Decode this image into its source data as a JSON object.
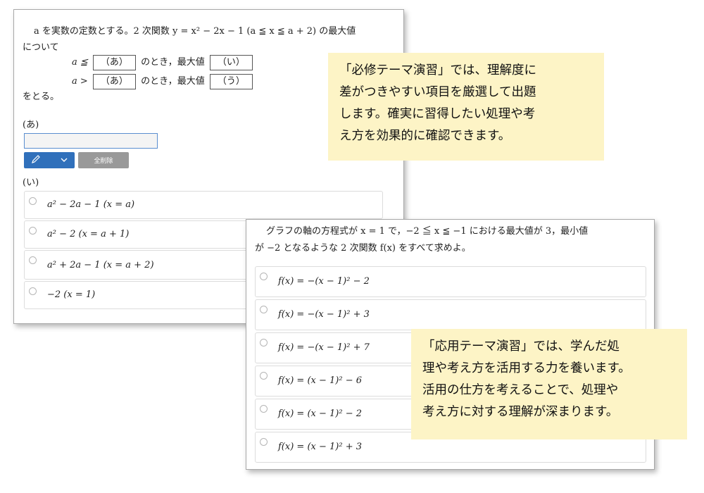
{
  "question1": {
    "line1": "a を実数の定数とする。2 次関数 y = x² − 2x − 1 (a ≦ x ≦ a + 2) の最大値",
    "line2": "について",
    "case1_lhs": "a ≦",
    "case2_lhs": "a >",
    "blank_a": "（あ）",
    "blank_i": "（い）",
    "blank_u": "（う）",
    "case_mid": "のとき，最大値",
    "line_end": "をとる。",
    "label_a": "(あ)",
    "label_i": "(い)",
    "clear_label": "全削除",
    "options": [
      "a² − 2a − 1 (x = a)",
      "a² − 2 (x = a + 1)",
      "a² + 2a − 1 (x = a + 2)",
      "−2 (x = 1)"
    ]
  },
  "question2": {
    "line1": "グラフの軸の方程式が x = 1 で，−2 ≦ x ≦ −1 における最大値が 3，最小値",
    "line2": "が −2 となるような 2 次関数 f(x) をすべて求めよ。",
    "options": [
      "f(x) = −(x − 1)² − 2",
      "f(x) = −(x − 1)² + 3",
      "f(x) = −(x − 1)² + 7",
      "f(x) = (x − 1)² − 6",
      "f(x) = (x − 1)² − 2",
      "f(x) = (x − 1)² + 3"
    ]
  },
  "notes": {
    "note1": [
      "「必修テーマ演習」では、理解度に",
      "差がつきやすい項目を厳選して出題",
      "します。確実に習得したい処理や考",
      "え方を効果的に確認できます。"
    ],
    "note2": [
      "「応用テーマ演習」では、学んだ処",
      "理や考え方を活用する力を養います。",
      "活用の仕方を考えることで、処理や",
      "考え方に対する理解が深まります。"
    ]
  },
  "icons": {
    "pen": "pencil-icon",
    "dropdown": "chevron-down-icon"
  },
  "colors": {
    "note_bg": "#fdf4c6",
    "pen_button": "#3070bb",
    "clear_button": "#999999"
  }
}
